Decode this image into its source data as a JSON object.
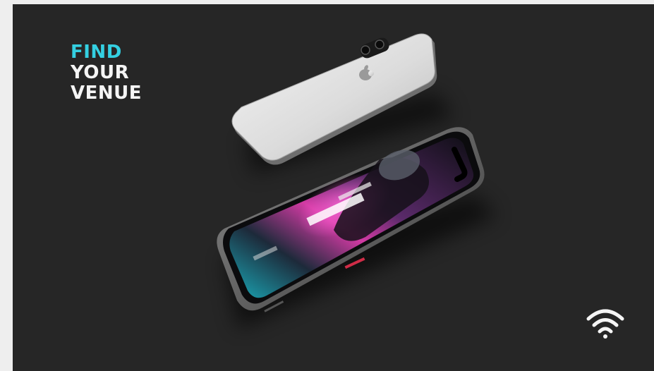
{
  "headline": {
    "line1": "FIND",
    "line2": "YOUR",
    "line3": "VENUE"
  },
  "icons": {
    "status": "wifi-icon",
    "brand": "apple-logo-icon"
  },
  "colors": {
    "background": "#262626",
    "accent": "#34d0e2",
    "text": "#f5f5f5",
    "page": "#eeeeee"
  }
}
